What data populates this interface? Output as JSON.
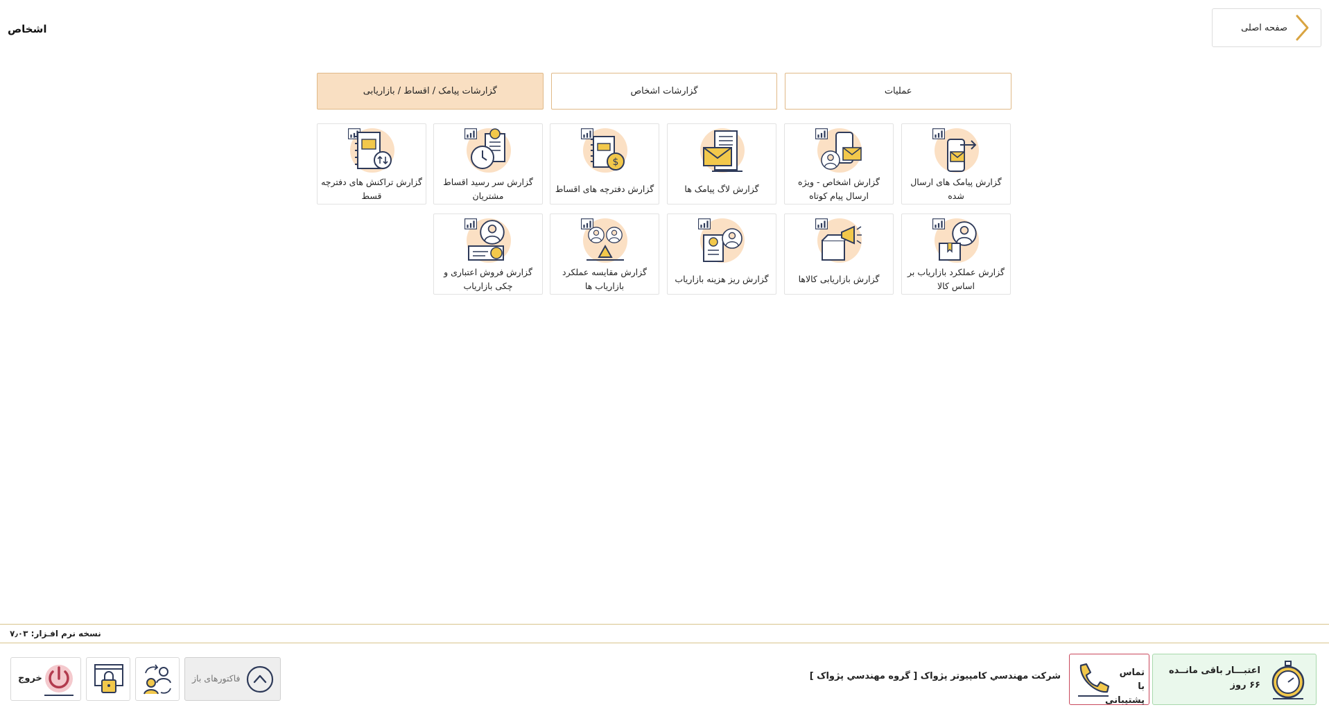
{
  "header": {
    "home_label": "صفحه اصلی",
    "page_title": "اشخاص"
  },
  "tabs": [
    {
      "label": "عملیات",
      "active": false
    },
    {
      "label": "گزارشات اشخاص",
      "active": false
    },
    {
      "label": "گزارشات پیامک / اقساط / بازاریابی",
      "active": true
    }
  ],
  "tiles": [
    {
      "label": "گزارش پیامک های ارسال شده",
      "icon": "sms-sent-report-icon"
    },
    {
      "label": "گزارش اشخاص - ویژه ارسال پیام کوتاه",
      "icon": "persons-sms-report-icon"
    },
    {
      "label": "گزارش لاگ پیامک ها",
      "icon": "sms-log-icon"
    },
    {
      "label": "گزارش دفترچه های اقساط",
      "icon": "installment-books-icon"
    },
    {
      "label": "گزارش سر رسید اقساط مشتریان",
      "icon": "installment-due-icon"
    },
    {
      "label": "گزارش تراکنش های دفترچه قسط",
      "icon": "installment-transactions-icon"
    },
    {
      "label": "گزارش عملکرد بازاریاب بر اساس کالا",
      "icon": "marketer-performance-icon"
    },
    {
      "label": "گزارش بازاریابی کالاها",
      "icon": "product-marketing-icon"
    },
    {
      "label": "گزارش ریز هزینه بازاریاب",
      "icon": "marketer-cost-icon"
    },
    {
      "label": "گزارش مقایسه عملکرد بازاریاب ها",
      "icon": "marketer-compare-icon"
    },
    {
      "label": "گزارش فروش اعتباری و چکی بازاریاب",
      "icon": "credit-sales-icon"
    }
  ],
  "footer": {
    "version": "نسخه نرم افـزار: ۷٫۰۳",
    "credit_line1": "اعتبـــار باقی مانــده",
    "credit_line2": "۶۶ روز",
    "support": "تماس با پشتیبانی",
    "company": "شرکت مهندسي کامپيوتر پژواک [ گروه مهندسي پژواک ]",
    "open_invoices": "فاکتورهای باز",
    "exit": "خروج"
  },
  "colors": {
    "accent_gold": "#d9a441",
    "tab_border": "#e0b987",
    "tab_active": "#f9dfc2",
    "icon_peach": "#fbe0c4",
    "icon_navy": "#2e3a59",
    "icon_yellow": "#f2c84b",
    "credit_bg": "#eaf8ec",
    "support_border": "#c9475b"
  }
}
